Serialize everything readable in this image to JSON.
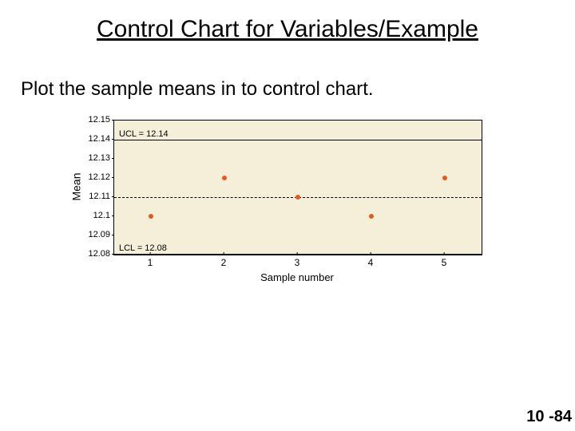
{
  "title": "Control Chart for Variables/Example",
  "subtitle": "Plot the sample means in to control chart.",
  "page_number": "10 -84",
  "chart_data": {
    "type": "scatter",
    "title": "",
    "xlabel": "Sample number",
    "ylabel": "Mean",
    "y_ticks": [
      12.08,
      12.09,
      12.1,
      12.11,
      12.12,
      12.13,
      12.14,
      12.15
    ],
    "ylim": [
      12.08,
      12.15
    ],
    "x_ticks": [
      1,
      2,
      3,
      4,
      5
    ],
    "xlim": [
      0.5,
      5.5
    ],
    "points": [
      {
        "x": 1,
        "y": 12.1
      },
      {
        "x": 2,
        "y": 12.12
      },
      {
        "x": 3,
        "y": 12.11
      },
      {
        "x": 4,
        "y": 12.1
      },
      {
        "x": 5,
        "y": 12.12
      }
    ],
    "reference_lines": {
      "ucl": {
        "value": 12.14,
        "label": "UCL = 12.14"
      },
      "center": {
        "value": 12.11,
        "label": ""
      },
      "lcl": {
        "value": 12.08,
        "label": "LCL = 12.08"
      }
    },
    "plot_bg": "#f5eed9",
    "point_color": "#e85a1a"
  }
}
